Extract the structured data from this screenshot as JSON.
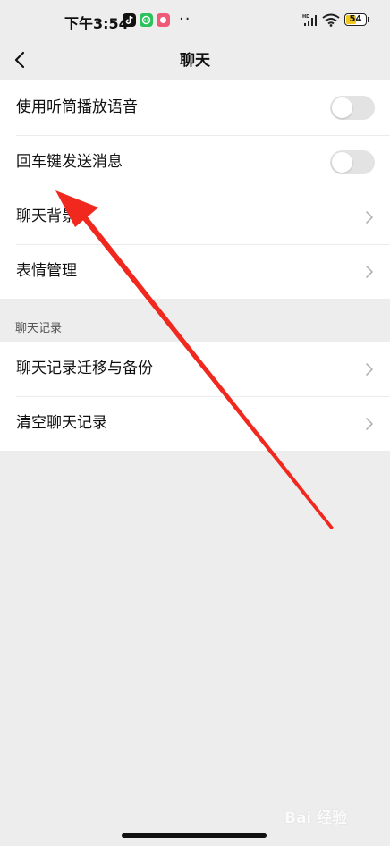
{
  "status_bar": {
    "time": "下午3:54",
    "more": "··",
    "network": "HD",
    "battery_level": "54",
    "battery_fraction": 0.54,
    "battery_color": "#f2c61a",
    "app_icons": [
      "tiktok-icon",
      "wechat-icon",
      "xiaohongshu-icon"
    ]
  },
  "nav": {
    "title": "聊天",
    "back_icon": "chevron-left-icon"
  },
  "settings_group_1": {
    "items": [
      {
        "label": "使用听筒播放语音",
        "control": "toggle",
        "on": false
      },
      {
        "label": "回车键发送消息",
        "control": "toggle",
        "on": false
      },
      {
        "label": "聊天背景",
        "control": "chevron"
      },
      {
        "label": "表情管理",
        "control": "chevron"
      }
    ]
  },
  "section_header": "聊天记录",
  "settings_group_2": {
    "items": [
      {
        "label": "聊天记录迁移与备份",
        "control": "chevron"
      },
      {
        "label": "清空聊天记录",
        "control": "chevron"
      }
    ]
  },
  "annotation": {
    "type": "red-arrow",
    "color": "#f0281e"
  },
  "watermark": {
    "text": "Bai 经验"
  },
  "colors": {
    "background": "#ededed",
    "card": "#ffffff",
    "toggle_off": "#e3e3e3",
    "text": "#111111"
  }
}
